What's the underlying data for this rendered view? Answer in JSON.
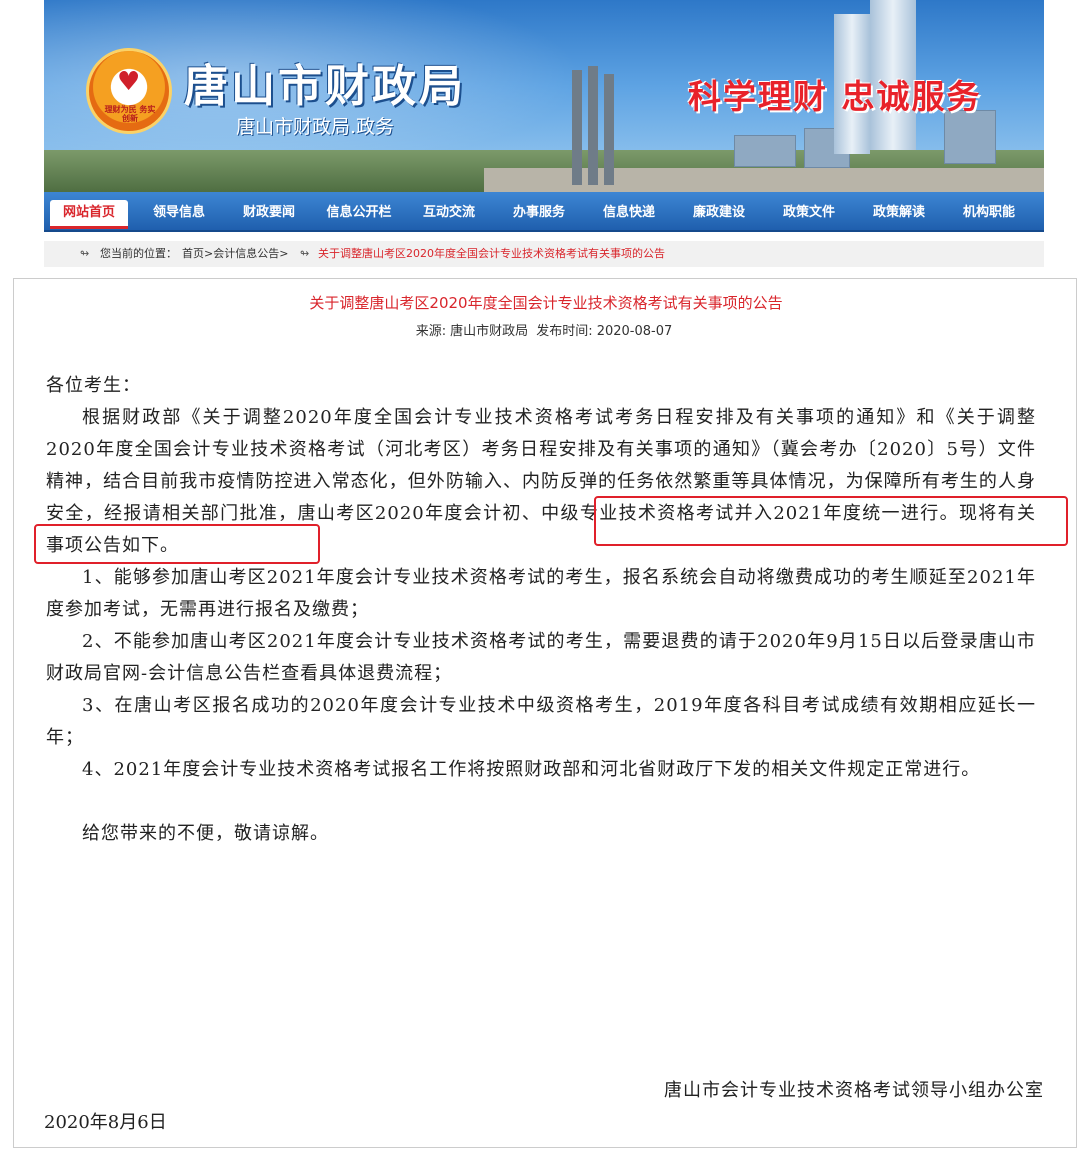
{
  "header": {
    "site_title": "唐山市财政局",
    "site_subtitle": "唐山市财政局.政务",
    "slogan": "科学理财 忠诚服务",
    "logo_motto": "理财为民 务实创新"
  },
  "nav": {
    "items": [
      {
        "label": "网站首页",
        "active": true
      },
      {
        "label": "领导信息"
      },
      {
        "label": "财政要闻"
      },
      {
        "label": "信息公开栏"
      },
      {
        "label": "互动交流"
      },
      {
        "label": "办事服务"
      },
      {
        "label": "信息快递"
      },
      {
        "label": "廉政建设"
      },
      {
        "label": "政策文件"
      },
      {
        "label": "政策解读"
      },
      {
        "label": "机构职能"
      }
    ]
  },
  "breadcrumb": {
    "label": "您当前的位置：",
    "path": "首页>会计信息公告>",
    "current": "关于调整唐山考区2020年度全国会计专业技术资格考试有关事项的公告"
  },
  "article": {
    "title": "关于调整唐山考区2020年度全国会计专业技术资格考试有关事项的公告",
    "source_label": "来源:",
    "source": "唐山市财政局",
    "date_label": "发布时间:",
    "date": "2020-08-07",
    "greeting": "各位考生：",
    "p1_a": "根据财政部《关于调整2020年度全国会计专业技术资格考试考务日程安排及有关事项的通知》和《关于调整2020年度全国会计专业技术资格考试（河北考区）考务日程安排及有关事项的通知》（冀会考办〔2020〕5号）文件精神，结合目前我市疫情防控进入常态化，但外防输入、内防反弹的任务依然繁重等具体情况，为保障所有考生的人身安全，经报请相关部门批准，",
    "p1_highlight": "唐山考区2020年度会计初、中级专业技术资格考试并入2021年度统一进行。",
    "p1_b": "现将有关事项公告如下。",
    "items": [
      "1、能够参加唐山考区2021年度会计专业技术资格考试的考生，报名系统会自动将缴费成功的考生顺延至2021年度参加考试，无需再进行报名及缴费；",
      "2、不能参加唐山考区2021年度会计专业技术资格考试的考生，需要退费的请于2020年9月15日以后登录唐山市财政局官网-会计信息公告栏查看具体退费流程；",
      "3、在唐山考区报名成功的2020年度会计专业技术中级资格考生，2019年度各科目考试成绩有效期相应延长一年；",
      "4、2021年度会计专业技术资格考试报名工作将按照财政部和河北省财政厅下发的相关文件规定正常进行。"
    ],
    "closing": "给您带来的不便，敬请谅解。",
    "signer": "唐山市会计专业技术资格考试领导小组办公室",
    "sign_date": "2020年8月6日"
  },
  "colors": {
    "accent_red": "#d9262c",
    "nav_blue": "#1f5fae",
    "annotation_red": "#e0202a"
  }
}
